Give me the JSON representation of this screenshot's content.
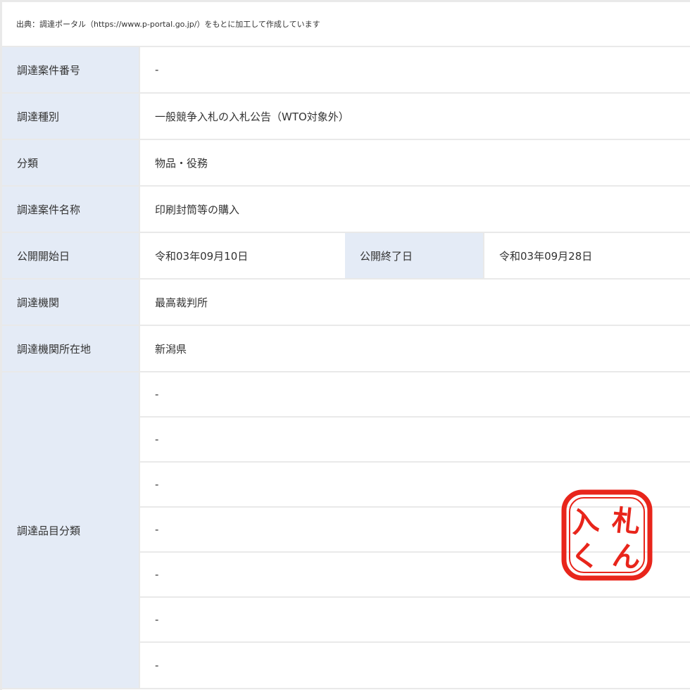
{
  "source_note": "出典：調達ポータル（https://www.p-portal.go.jp/）をもとに加工して作成しています",
  "rows": [
    {
      "label": "調達案件番号",
      "value": "-"
    },
    {
      "label": "調達種別",
      "value": "一般競争入札の入札公告（WTO対象外）"
    },
    {
      "label": "分類",
      "value": "物品・役務"
    },
    {
      "label": "調達案件名称",
      "value": "印刷封筒等の購入"
    }
  ],
  "dates": {
    "start_label": "公開開始日",
    "start_value": "令和03年09月10日",
    "end_label": "公開終了日",
    "end_value": "令和03年09月28日"
  },
  "rows2": [
    {
      "label": "調達機関",
      "value": "最高裁判所"
    },
    {
      "label": "調達機関所在地",
      "value": "新潟県"
    }
  ],
  "category": {
    "label": "調達品目分類",
    "values": [
      "-",
      "-",
      "-",
      "-",
      "-",
      "-",
      "-"
    ]
  },
  "seal": {
    "text": "入札くん",
    "color": "#e8251b"
  }
}
